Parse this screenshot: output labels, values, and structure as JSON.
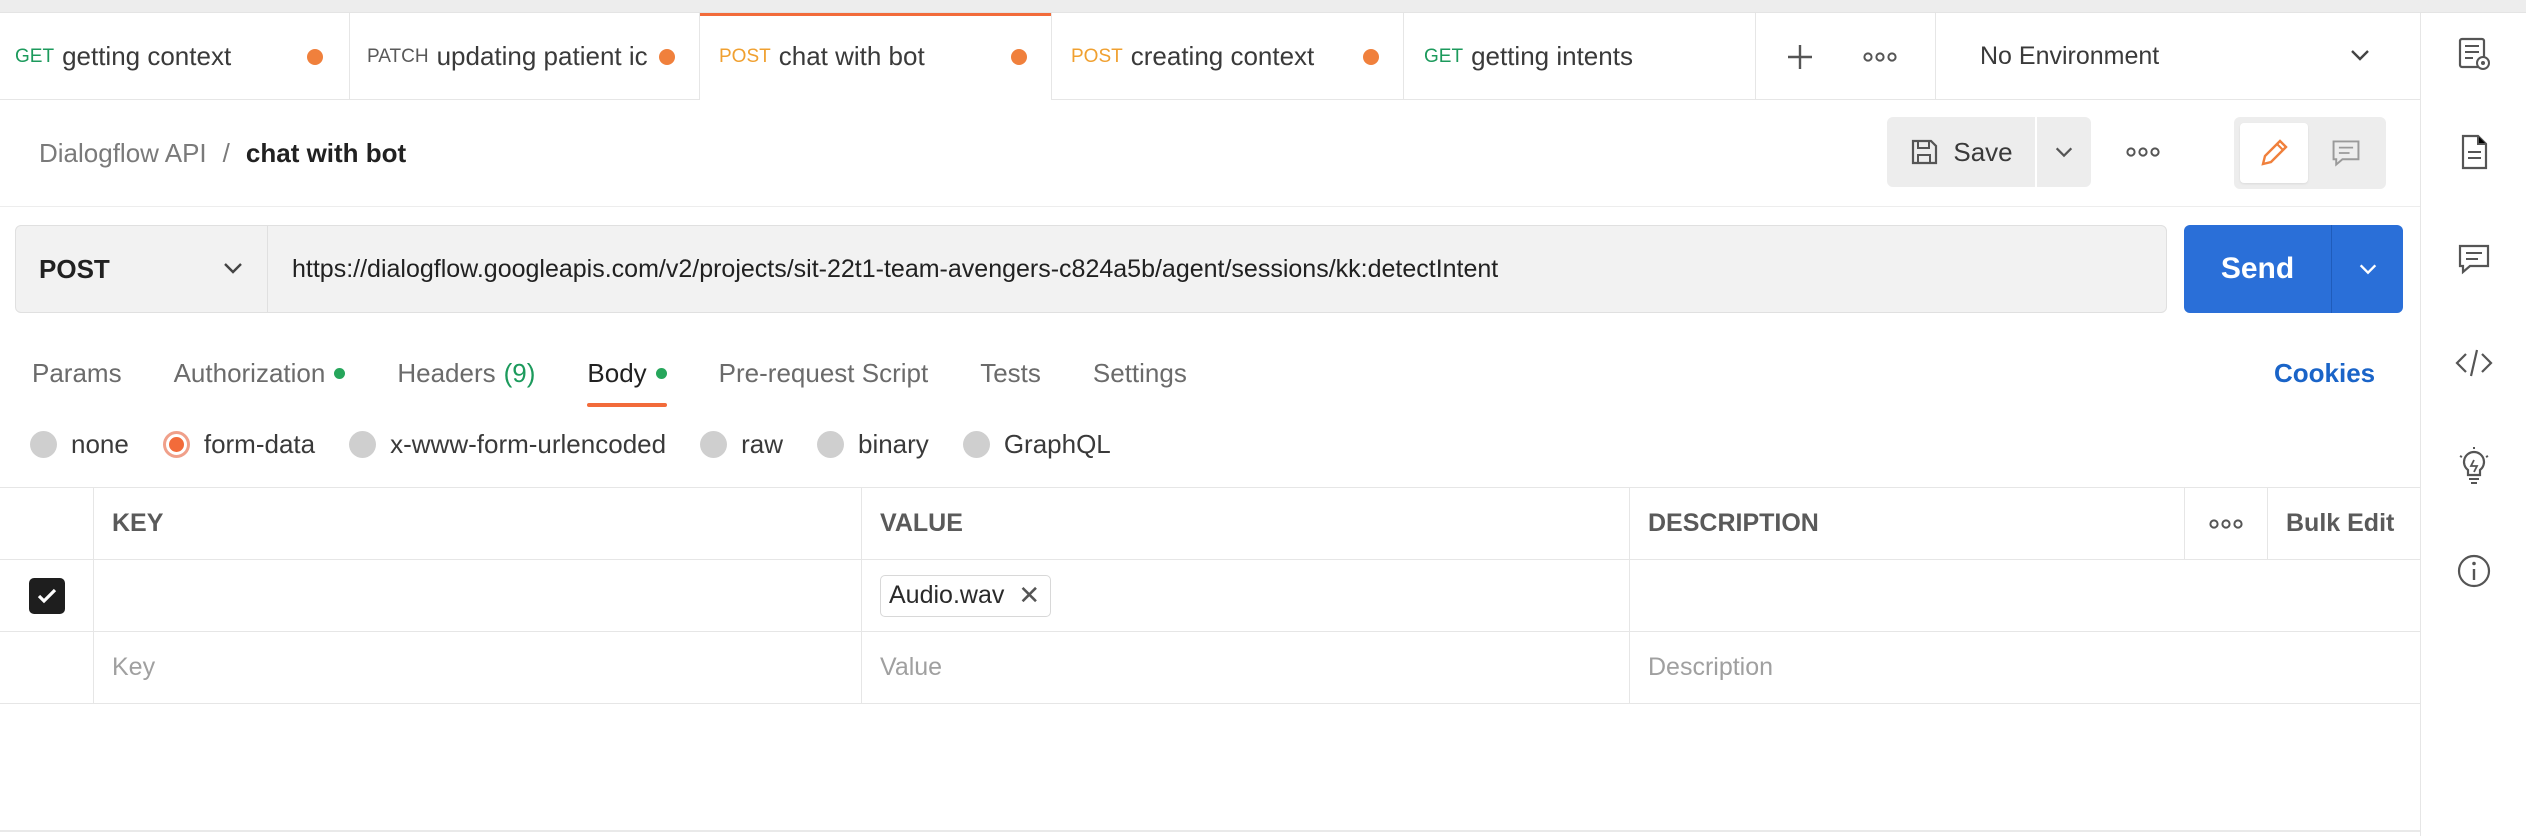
{
  "tabs": [
    {
      "method": "GET",
      "name": "getting context",
      "unsaved": true,
      "active": false
    },
    {
      "method": "PATCH",
      "name": "updating patient ic",
      "unsaved": true,
      "active": false
    },
    {
      "method": "POST",
      "name": "chat with bot",
      "unsaved": true,
      "active": true
    },
    {
      "method": "POST",
      "name": "creating context",
      "unsaved": true,
      "active": false
    },
    {
      "method": "GET",
      "name": "getting intents",
      "unsaved": false,
      "active": false
    }
  ],
  "environment": {
    "selected": "No Environment"
  },
  "breadcrumb": {
    "collection": "Dialogflow API",
    "separator": "/",
    "request": "chat with bot"
  },
  "toolbar": {
    "save_label": "Save"
  },
  "request": {
    "method": "POST",
    "url": "https://dialogflow.googleapis.com/v2/projects/sit-22t1-team-avengers-c824a5b/agent/sessions/kk:detectIntent",
    "send_label": "Send"
  },
  "request_tabs": {
    "params": "Params",
    "authorization": "Authorization",
    "headers": "Headers",
    "headers_count": "(9)",
    "body": "Body",
    "pre_request": "Pre-request Script",
    "tests": "Tests",
    "settings": "Settings",
    "cookies": "Cookies",
    "active": "Body"
  },
  "body_types": {
    "none": "none",
    "form_data": "form-data",
    "urlencoded": "x-www-form-urlencoded",
    "raw": "raw",
    "binary": "binary",
    "graphql": "GraphQL",
    "selected": "form-data"
  },
  "table": {
    "headers": {
      "key": "KEY",
      "value": "VALUE",
      "description": "DESCRIPTION",
      "bulk_edit": "Bulk Edit"
    },
    "rows": [
      {
        "checked": true,
        "key": "",
        "value_file": "Audio.wav",
        "description": ""
      }
    ],
    "placeholders": {
      "key": "Key",
      "value": "Value",
      "description": "Description"
    }
  },
  "colors": {
    "accent": "#f26b3a",
    "send": "#2a6fd8",
    "get": "#1c9a5c",
    "post": "#f0a030",
    "status_dot": "#26a65b",
    "link": "#1a64c8"
  }
}
